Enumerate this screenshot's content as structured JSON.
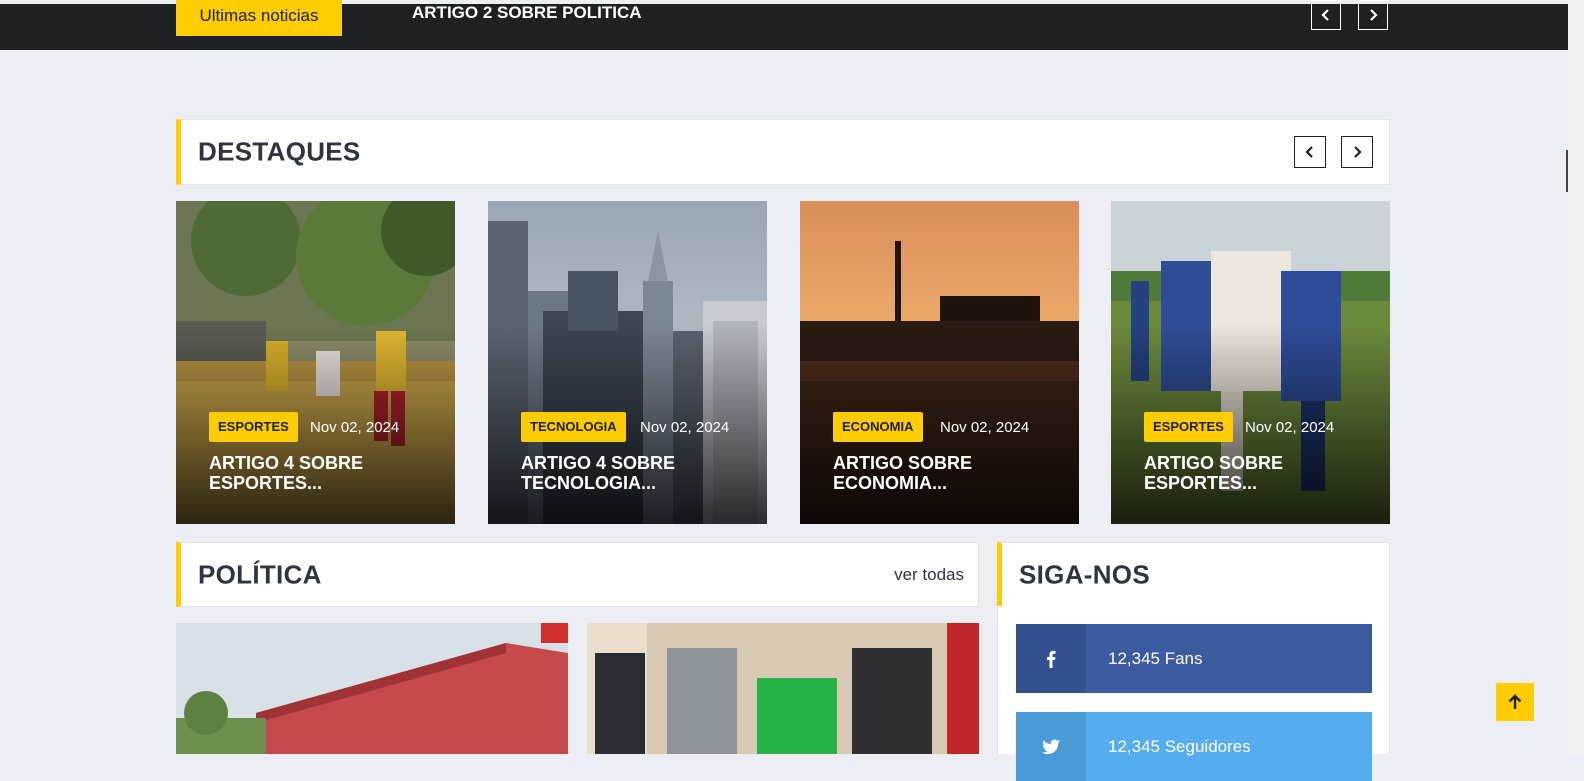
{
  "ticker": {
    "label": "Ultimas noticias",
    "headline": "ARTIGO 2 SOBRE POLITICA"
  },
  "featured": {
    "title": "DESTAQUES",
    "cards": [
      {
        "category": "ESPORTES",
        "date": "Nov 02, 2024",
        "title": "ARTIGO 4 SOBRE ESPORTES..."
      },
      {
        "category": "TECNOLOGIA",
        "date": "Nov 02, 2024",
        "title": "ARTIGO 4 SOBRE TECNOLOGIA..."
      },
      {
        "category": "ECONOMIA",
        "date": "Nov 02, 2024",
        "title": "ARTIGO SOBRE ECONOMIA..."
      },
      {
        "category": "ESPORTES",
        "date": "Nov 02, 2024",
        "title": "ARTIGO SOBRE ESPORTES..."
      }
    ]
  },
  "politics": {
    "title": "POLÍTICA",
    "see_all": "ver todas"
  },
  "follow": {
    "title": "SIGA-NOS",
    "facebook": {
      "label": "12,345 Fans",
      "color": "#39569c"
    },
    "twitter": {
      "label": "12,345 Seguidores",
      "color": "#52aaf4"
    }
  },
  "colors": {
    "accent": "#ffcc00",
    "dark": "#1f2024",
    "text": "#2f3540"
  },
  "icons": [
    "chevron-left-icon",
    "chevron-right-icon",
    "facebook-icon",
    "twitter-icon",
    "arrow-up-icon"
  ]
}
